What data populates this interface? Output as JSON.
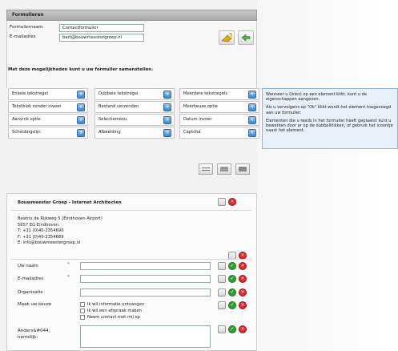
{
  "header": {
    "title": "Formulieren"
  },
  "form_meta": {
    "name_label": "Formuliernaam",
    "name_value": "Contactformulier",
    "email_label": "E-mailadres",
    "email_value": "bart@bouwmeestergroep.nl"
  },
  "palette": {
    "heading": "Met deze mogelijkheden kunt u uw formulier samenstellen.",
    "items": [
      "Enkele tekstregel",
      "Dubbele tekstregel",
      "Meerdere tekstregels",
      "Tekstblok zonder invoer",
      "Bestand verzenden",
      "Meerkeuze optie",
      "Aanvink optie",
      "Selectiemenu",
      "Datum invoer",
      "Scheidingslijn",
      "Afbeelding",
      "Captcha"
    ]
  },
  "help": {
    "p1": "Wanneer u (links) op een element klikt, kunt u de eigenschappen aangeven.",
    "p2": "Als u vervolgens op \"Ok\" klikt wordt het element toegevoegd aan uw formulier.",
    "p3": "Elementen die u reeds in het formulier heeft geplaatst kunt u bewerken door er op de dubbelklikken, of gebruik het icoontje naast het element."
  },
  "preview": {
    "company": "Bouwmeester Groep - Internet Architecten",
    "address": [
      "Beatrix de Rijkweg 5 (Eindhoven Airport)",
      "5657 EG Eindhoven.",
      "T: +31 (0)40-2354690",
      "F: +31 (0)40-2354689",
      "E: info@bouwmeestergroep.nl"
    ],
    "fields": {
      "name": "Uw naam",
      "email": "E-mailadres",
      "org": "Organisatie",
      "choice": "Maak uw keuze",
      "other": "Anders&#044; namelijk:"
    },
    "required_mark": "*",
    "options": [
      "Ik wil informatie ontvangen",
      "Ik wil een afspraak maken",
      "Neem contact met mij op"
    ]
  },
  "icons": {
    "save": "save-icon",
    "undo": "undo-icon",
    "palette_add": "plus-icon",
    "edit": "edit-icon",
    "ok": "check-icon",
    "delete": "delete-icon"
  },
  "colors": {
    "help_bg": "#e8f1fb",
    "ok": "#2ea02e",
    "delete": "#dd2b2b",
    "palette_btn": "#3d86d2"
  }
}
